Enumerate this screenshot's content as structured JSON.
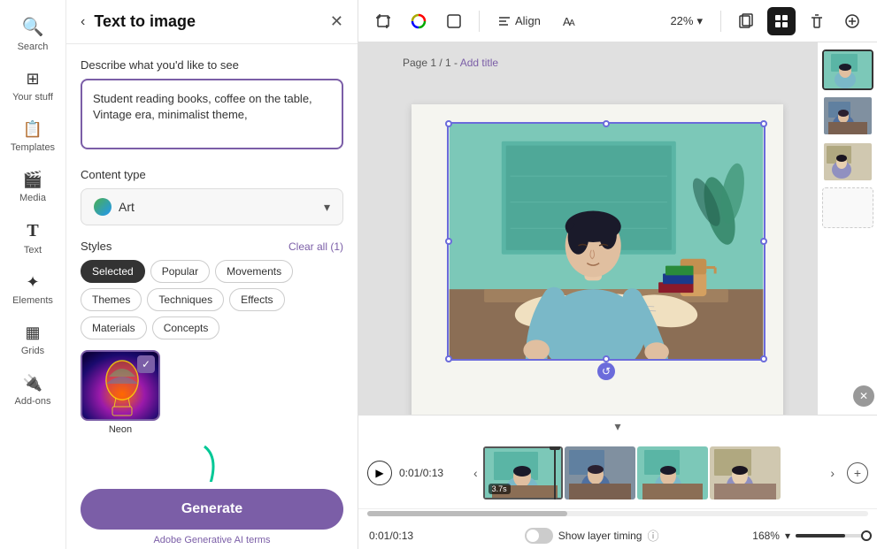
{
  "sidebar": {
    "items": [
      {
        "id": "search",
        "label": "Search",
        "icon": "🔍"
      },
      {
        "id": "your-stuff",
        "label": "Your stuff",
        "icon": "⊞"
      },
      {
        "id": "templates",
        "label": "Templates",
        "icon": "📄"
      },
      {
        "id": "media",
        "label": "Media",
        "icon": "🎬"
      },
      {
        "id": "text",
        "label": "Text",
        "icon": "T"
      },
      {
        "id": "elements",
        "label": "Elements",
        "icon": "✦"
      },
      {
        "id": "grids",
        "label": "Grids",
        "icon": "▦"
      },
      {
        "id": "add-ons",
        "label": "Add-ons",
        "icon": "🔌"
      }
    ]
  },
  "panel": {
    "back_label": "‹",
    "title": "Text to image",
    "close_label": "✕",
    "describe_label": "Describe what you'd like to see",
    "describe_placeholder": "Student reading books, coffee on the table, Vintage era, minimalist theme,",
    "describe_value": "Student reading books, coffee on the table, Vintage era, minimalist theme,",
    "content_type_label": "Content type",
    "content_type_value": "Art",
    "styles_label": "Styles",
    "clear_all_label": "Clear all (1)",
    "style_tags": [
      {
        "id": "selected",
        "label": "Selected",
        "active": true
      },
      {
        "id": "popular",
        "label": "Popular",
        "active": false
      },
      {
        "id": "movements",
        "label": "Movements",
        "active": false
      },
      {
        "id": "themes",
        "label": "Themes",
        "active": false
      },
      {
        "id": "techniques",
        "label": "Techniques",
        "active": false
      },
      {
        "id": "effects",
        "label": "Effects",
        "active": false
      },
      {
        "id": "materials",
        "label": "Materials",
        "active": false
      },
      {
        "id": "concepts",
        "label": "Concepts",
        "active": false
      }
    ],
    "style_thumbs": [
      {
        "id": "neon",
        "label": "Neon",
        "checked": true
      }
    ],
    "generate_label": "Generate",
    "ai_terms_label": "Adobe Generative AI terms"
  },
  "toolbar": {
    "zoom_value": "22%",
    "align_label": "Align",
    "icons": [
      "crop-icon",
      "color-wheel-icon",
      "frame-icon",
      "align-icon",
      "language-icon"
    ],
    "right_icons": [
      "pages-icon",
      "grid-icon",
      "delete-icon",
      "add-icon"
    ]
  },
  "canvas": {
    "page_label": "Page 1 / 1 -",
    "add_title_label": "Add title"
  },
  "timeline": {
    "time_display": "0:01/0:13",
    "show_layer_timing_label": "Show layer timing",
    "zoom_level": "168%",
    "frame_duration": "3.7s"
  }
}
